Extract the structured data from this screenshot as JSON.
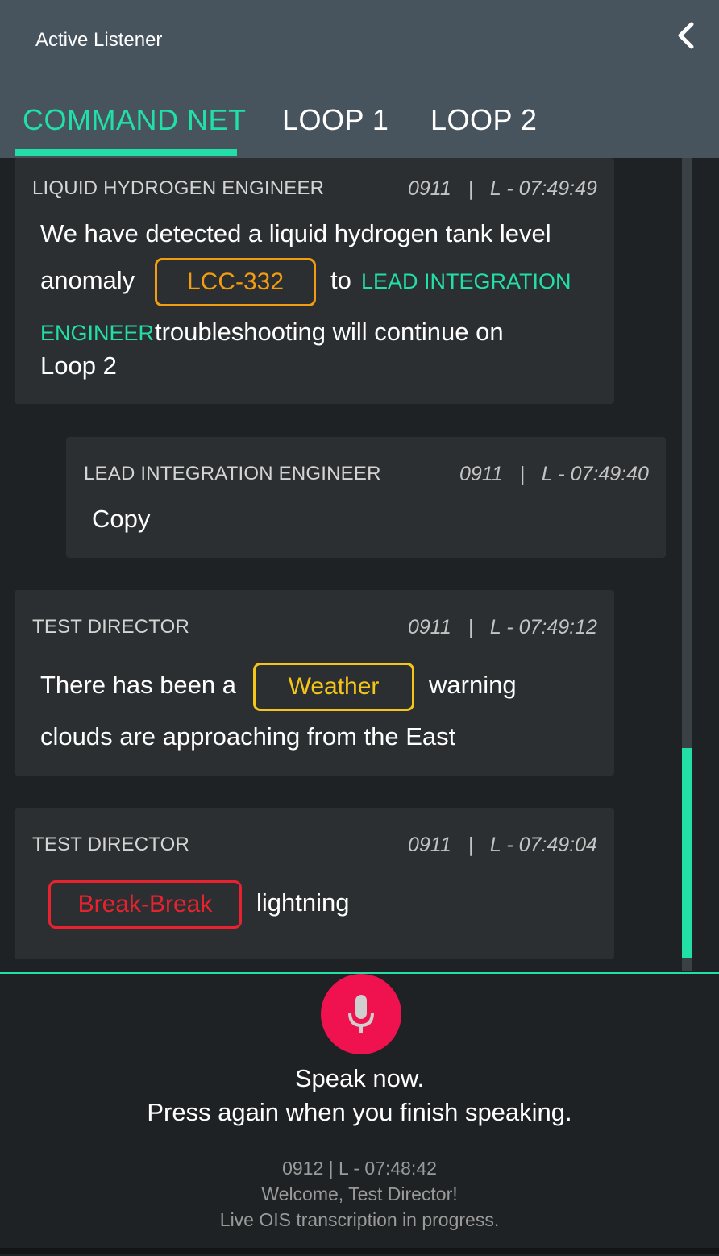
{
  "header": {
    "title": "Active Listener",
    "back_icon": "chevron-left-icon"
  },
  "tabs": [
    {
      "label": "COMMAND NET",
      "active": true
    },
    {
      "label": "LOOP 1",
      "active": false
    },
    {
      "label": "LOOP 2",
      "active": false
    }
  ],
  "colors": {
    "accent": "#22dfa8",
    "header_bg": "#47545d",
    "card_bg": "#2b2f31",
    "page_bg": "#1f2224",
    "lcc_chip": "#f39c12",
    "weather_chip": "#f5c518",
    "break_chip": "#e8222f",
    "mic": "#f0114f"
  },
  "messages": [
    {
      "speaker": "LIQUID HYDROGEN ENGINEER",
      "meta": "0911   |   L - 07:49:49",
      "text_1": "We have detected a liquid hydrogen tank level",
      "text_2a": "anomaly",
      "chip": "LCC-332",
      "text_2b": "to",
      "role_a": "LEAD INTEGRATION",
      "role_b": "ENGINEER",
      "text_3": "troubleshooting will continue on",
      "text_4": "Loop 2"
    },
    {
      "speaker": "LEAD INTEGRATION ENGINEER",
      "meta": "0911   |   L - 07:49:40",
      "text_1": "Copy"
    },
    {
      "speaker": "TEST DIRECTOR",
      "meta": "0911   |   L - 07:49:12",
      "text_1a": "There has been a",
      "chip": "Weather",
      "text_1b": "warning",
      "text_2": "clouds are approaching from the East"
    },
    {
      "speaker": "TEST DIRECTOR",
      "meta": "0911   |   L - 07:49:04",
      "chip": "Break-Break",
      "text_1": "lightning"
    }
  ],
  "footer": {
    "mic_icon": "microphone-icon",
    "speak_line_1": "Speak now.",
    "speak_line_2": "Press again when you finish speaking.",
    "status_time": "0912 | L - 07:48:42",
    "welcome": "Welcome, Test Director!",
    "transcription": "Live OIS transcription in progress."
  }
}
